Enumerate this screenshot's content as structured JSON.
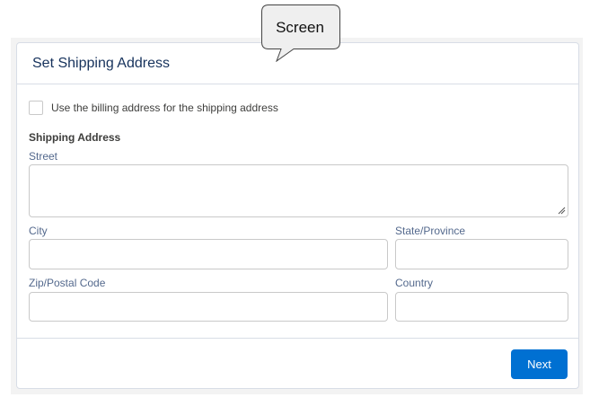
{
  "callout": {
    "label": "Screen"
  },
  "card": {
    "title": "Set Shipping Address",
    "billing_checkbox": {
      "label": "Use the billing address for the shipping address",
      "checked": false
    },
    "section_title": "Shipping Address",
    "fields": {
      "street": {
        "label": "Street",
        "value": ""
      },
      "city": {
        "label": "City",
        "value": ""
      },
      "state": {
        "label": "State/Province",
        "value": ""
      },
      "zip": {
        "label": "Zip/Postal Code",
        "value": ""
      },
      "country": {
        "label": "Country",
        "value": ""
      }
    },
    "next_label": "Next"
  },
  "colors": {
    "brand_button": "#0070d2",
    "title_text": "#16325c",
    "border": "#d8dde6"
  }
}
